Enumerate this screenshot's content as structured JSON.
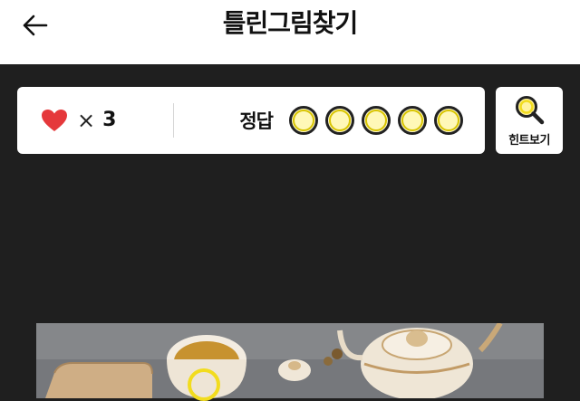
{
  "header": {
    "title": "틀린그림찾기",
    "back_icon": "arrow-left-icon"
  },
  "status": {
    "lives_icon": "heart-icon",
    "lives_multiplier": "×",
    "lives_count": "3",
    "answers_label": "정답",
    "answers_total": 5,
    "answers_found": 0
  },
  "hint": {
    "icon": "magnifier-icon",
    "label": "힌트보기"
  },
  "colors": {
    "background": "#1f1f1f",
    "heart": "#e5383b",
    "answer_slot": "#f2dc1e",
    "marker": "#f2dc1e"
  },
  "puzzle": {
    "scene": "tea-set-photo",
    "markers_shown": 1
  }
}
